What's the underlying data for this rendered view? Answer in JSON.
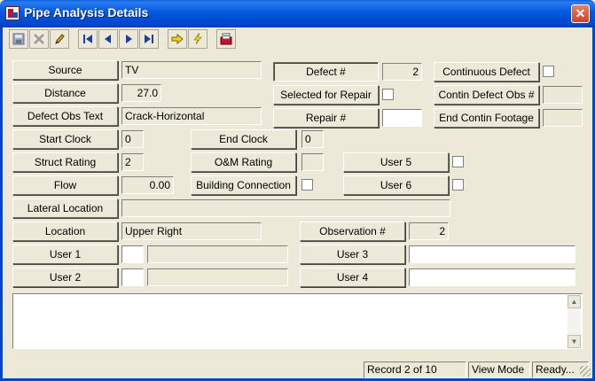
{
  "window": {
    "title": "Pipe Analysis Details",
    "close_glyph": "✕"
  },
  "toolbar": {
    "items": [
      "save-icon",
      "delete-icon",
      "edit-icon",
      "first-record-icon",
      "prev-record-icon",
      "next-record-icon",
      "last-record-icon",
      "go-icon",
      "flash-icon",
      "report-icon"
    ]
  },
  "fields": {
    "source": {
      "label": "Source",
      "value": "TV"
    },
    "distance": {
      "label": "Distance",
      "value": "27.0"
    },
    "defect_obs_text": {
      "label": "Defect Obs Text",
      "value": "Crack-Horizontal"
    },
    "start_clock": {
      "label": "Start Clock",
      "value": "0"
    },
    "struct_rating": {
      "label": "Struct Rating",
      "value": "2"
    },
    "flow": {
      "label": "Flow",
      "value": "0.00"
    },
    "lateral_location": {
      "label": "Lateral Location",
      "value": ""
    },
    "location": {
      "label": "Location",
      "value": "Upper Right"
    },
    "user1": {
      "label": "User 1",
      "value_a": "",
      "value_b": ""
    },
    "user2": {
      "label": "User 2",
      "value_a": "",
      "value_b": ""
    },
    "defect_num": {
      "label": "Defect #",
      "value": "2"
    },
    "selected_for_repair": {
      "label": "Selected for Repair"
    },
    "repair_num": {
      "label": "Repair #",
      "value": ""
    },
    "end_clock": {
      "label": "End Clock",
      "value": "0"
    },
    "om_rating": {
      "label": "O&M Rating",
      "value": ""
    },
    "building_connection": {
      "label": "Building Connection"
    },
    "continuous_defect": {
      "label": "Continuous Defect"
    },
    "contin_defect_obs": {
      "label": "Contin Defect Obs #",
      "value": ""
    },
    "end_contin_footage": {
      "label": "End Contin Footage",
      "value": ""
    },
    "user5": {
      "label": "User 5"
    },
    "user6": {
      "label": "User 6"
    },
    "observation_num": {
      "label": "Observation #",
      "value": "2"
    },
    "user3": {
      "label": "User 3",
      "value": ""
    },
    "user4": {
      "label": "User 4",
      "value": ""
    }
  },
  "notes": {
    "value": ""
  },
  "status": {
    "record": "Record 2 of 10",
    "mode": "View Mode",
    "state": "Ready..."
  }
}
